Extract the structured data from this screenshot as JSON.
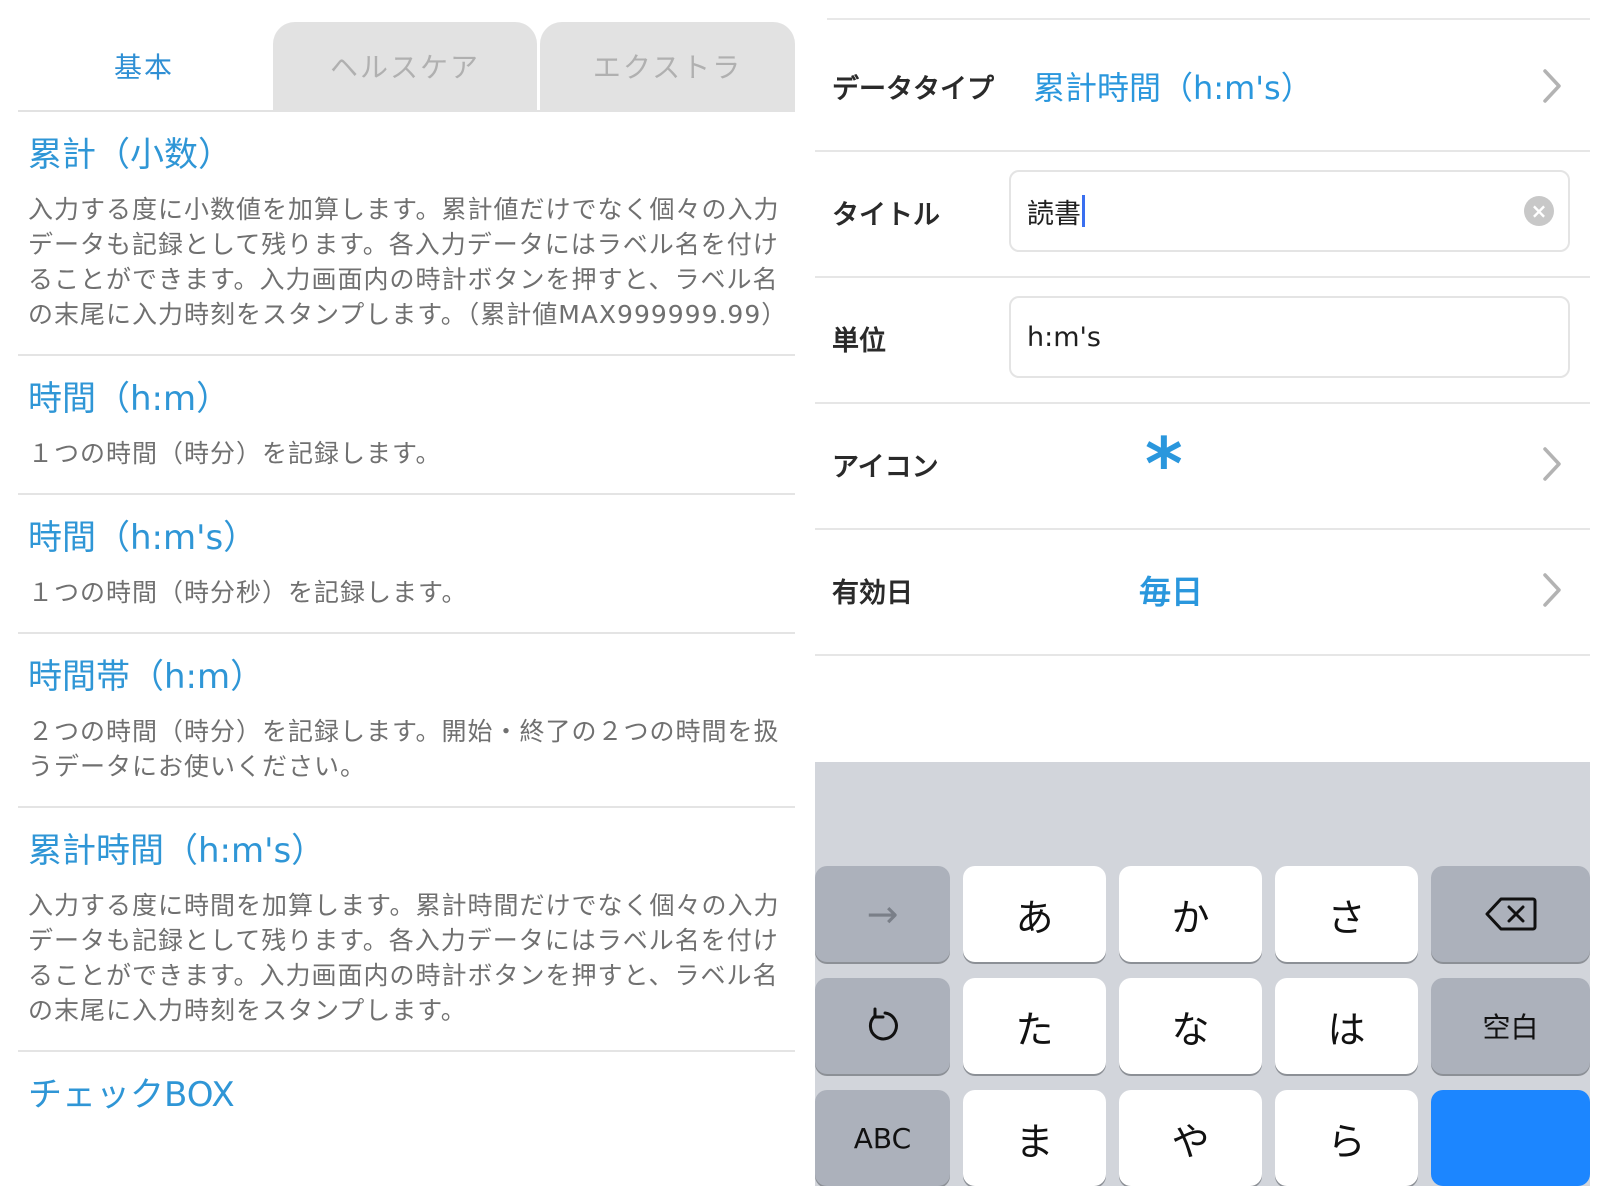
{
  "tabs": [
    {
      "label": "基本",
      "active": true
    },
    {
      "label": "ヘルスケア",
      "active": false
    },
    {
      "label": "エクストラ",
      "active": false
    }
  ],
  "data_types": [
    {
      "title": "累計（小数）",
      "description": "入力する度に小数値を加算します。累計値だけでなく個々の入力データも記録として残ります。各入力データにはラベル名を付けることができます。入力画面内の時計ボタンを押すと、ラベル名の末尾に入力時刻をスタンプします。（累計値MAX999999.99）"
    },
    {
      "title": "時間（h:m）",
      "description": "１つの時間（時分）を記録します。"
    },
    {
      "title": "時間（h:m's）",
      "description": "１つの時間（時分秒）を記録します。"
    },
    {
      "title": "時間帯（h:m）",
      "description": "２つの時間（時分）を記録します。開始・終了の２つの時間を扱うデータにお使いください。"
    },
    {
      "title": "累計時間（h:m's）",
      "description": "入力する度に時間を加算します。累計時間だけでなく個々の入力データも記録として残ります。各入力データにはラベル名を付けることができます。入力画面内の時計ボタンを押すと、ラベル名の末尾に入力時刻をスタンプします。"
    },
    {
      "title": "チェックBOX",
      "description": ""
    }
  ],
  "form": {
    "data_type": {
      "label": "データタイプ",
      "value": "累計時間（h:m's）"
    },
    "title": {
      "label": "タイトル",
      "value": "読書"
    },
    "unit": {
      "label": "単位",
      "value": "h:m's"
    },
    "icon": {
      "label": "アイコン",
      "value": "*",
      "icon_name": "asterisk-icon"
    },
    "valid_days": {
      "label": "有効日",
      "value": "毎日"
    }
  },
  "keyboard": {
    "rows": [
      [
        "→",
        "あ",
        "か",
        "さ",
        "backspace"
      ],
      [
        "undo",
        "た",
        "な",
        "は",
        "空白"
      ],
      [
        "ABC",
        "ま",
        "や",
        "ら",
        ""
      ]
    ],
    "labels": {
      "next": "→",
      "a": "あ",
      "ka": "か",
      "sa": "さ",
      "ta": "た",
      "na": "な",
      "ha": "は",
      "space": "空白",
      "abc": "ABC",
      "ma": "ま",
      "ya": "や",
      "ra": "ら"
    }
  },
  "colors": {
    "accent": "#2f96d6",
    "enter_key": "#1c86ff",
    "keyboard_bg": "#d2d5db"
  }
}
